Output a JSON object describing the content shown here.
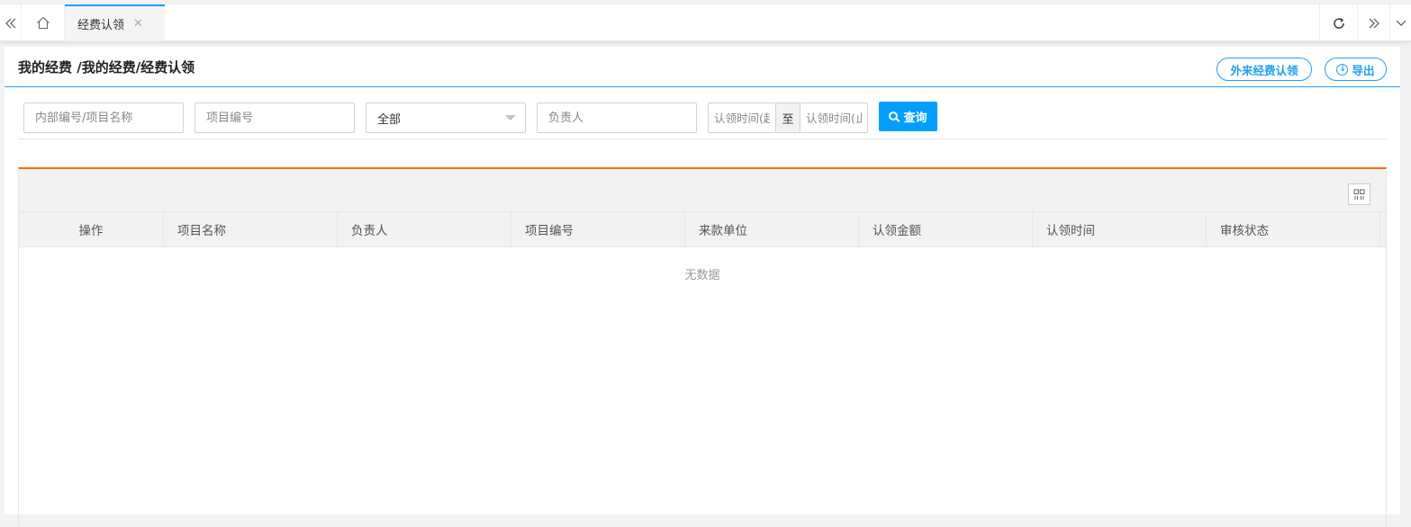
{
  "tabbar": {
    "nav_left_icon": "double-chevron-left",
    "home_icon": "home",
    "active_tab": "经费认领",
    "close_icon": "close",
    "refresh_icon": "refresh",
    "nav_right_icon": "double-chevron-right",
    "dropdown_icon": "chevron-down"
  },
  "header": {
    "title": "我的经费 /我的经费/经费认领",
    "external_button": "外来经费认领",
    "export_button": "导出"
  },
  "search": {
    "name_placeholder": "内部编号/项目名称",
    "number_placeholder": "项目编号",
    "status_select": "全部",
    "owner_placeholder": "负责人",
    "start_date_placeholder": "认领时间(起)",
    "to_label": "至",
    "end_date_placeholder": "认领时间(止)",
    "query_button": "查询"
  },
  "table": {
    "columns": [
      "操作",
      "项目名称",
      "负责人",
      "项目编号",
      "来款单位",
      "认领金额",
      "认领时间",
      "审核状态"
    ],
    "empty_text": "无数据"
  },
  "colors": {
    "primary": "#1e9fff",
    "query_button": "#009fff",
    "table_accent": "#ff6b00"
  }
}
